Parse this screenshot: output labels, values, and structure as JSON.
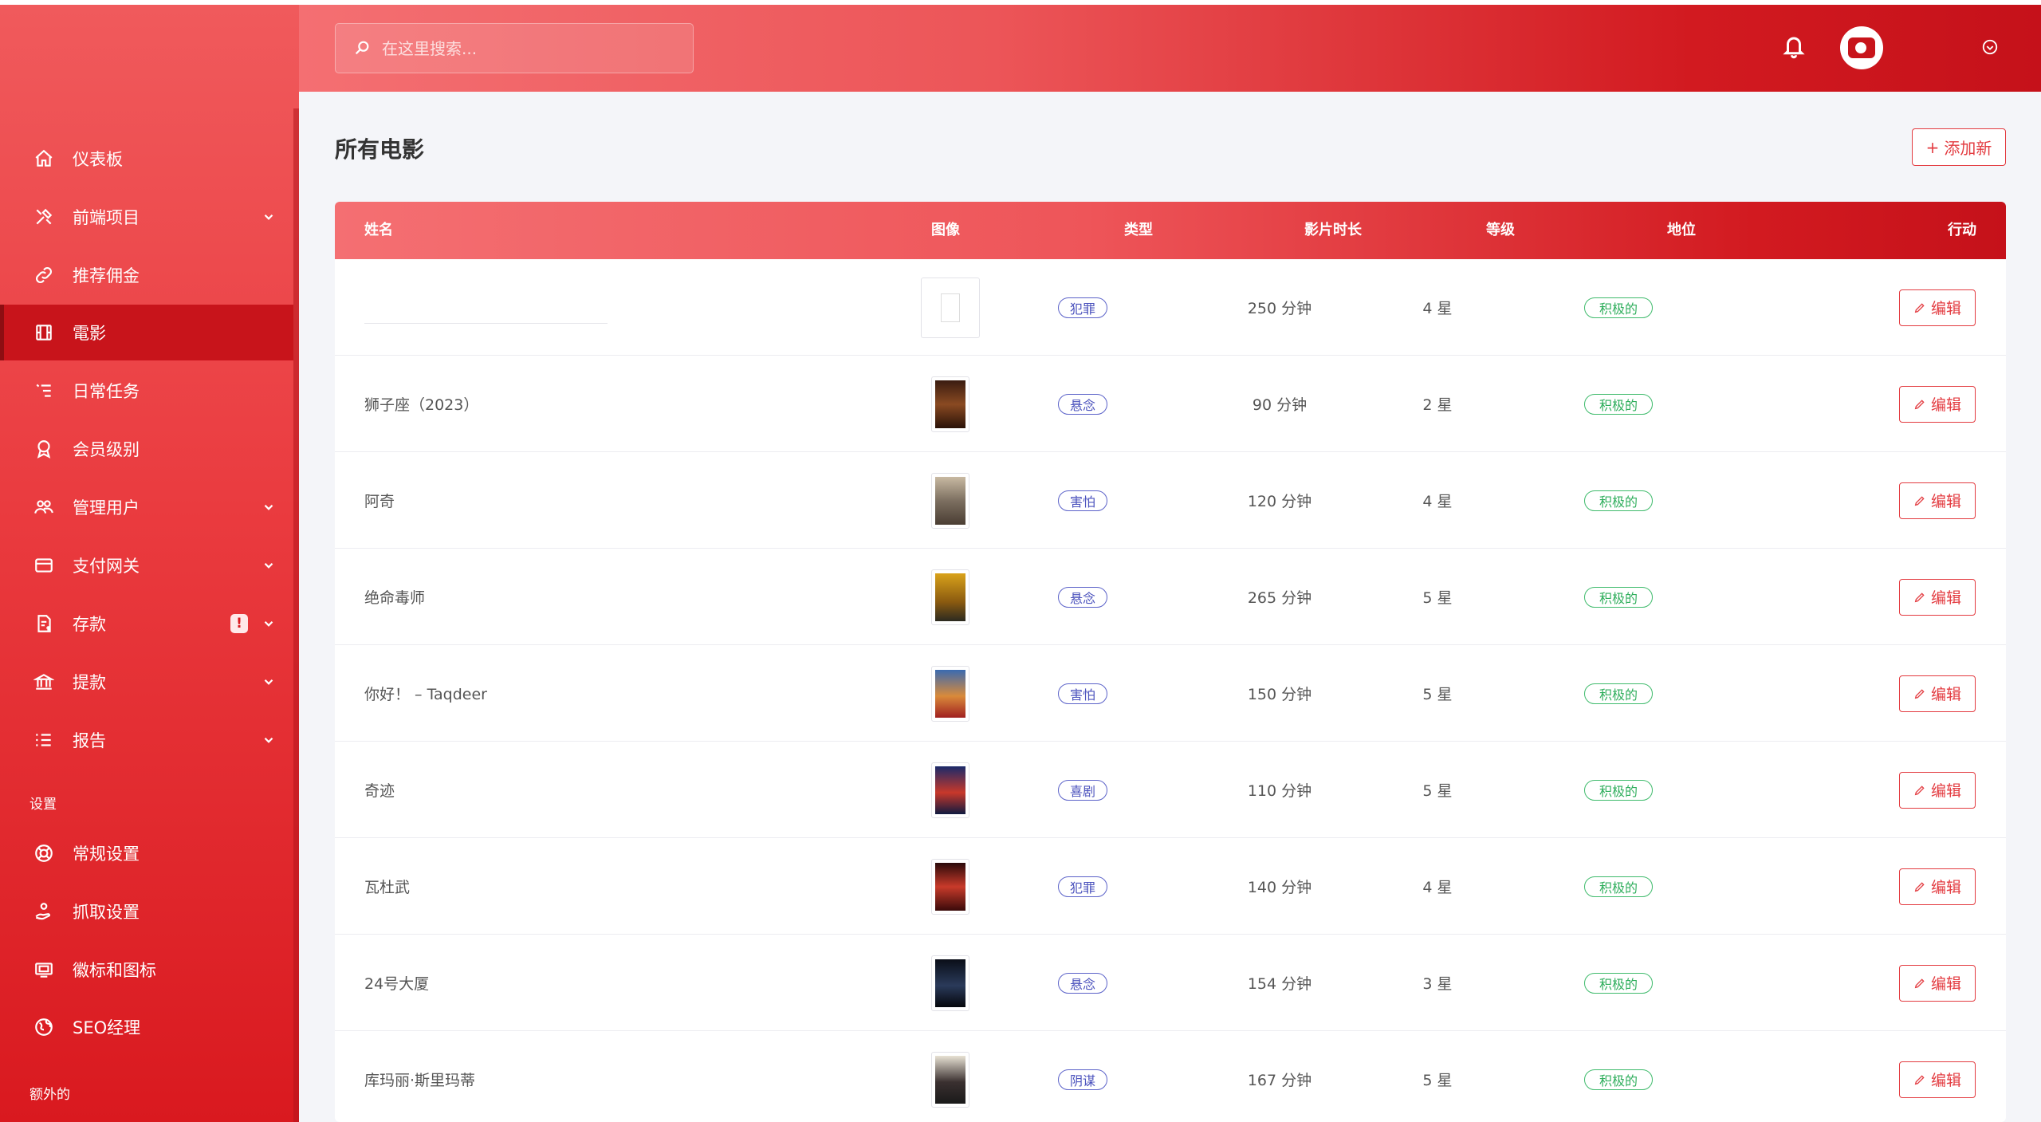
{
  "search": {
    "placeholder": "在这里搜索..."
  },
  "sidebar": {
    "items": [
      {
        "label": "仪表板",
        "icon": "home-icon",
        "has_submenu": false
      },
      {
        "label": "前端项目",
        "icon": "tools-icon",
        "has_submenu": true
      },
      {
        "label": "推荐佣金",
        "icon": "link-icon",
        "has_submenu": false
      },
      {
        "label": "電影",
        "icon": "film-icon",
        "has_submenu": false,
        "active": true
      },
      {
        "label": "日常任务",
        "icon": "task-list-icon",
        "has_submenu": false
      },
      {
        "label": "会员级别",
        "icon": "award-icon",
        "has_submenu": false
      },
      {
        "label": "管理用户",
        "icon": "users-icon",
        "has_submenu": true
      },
      {
        "label": "支付网关",
        "icon": "credit-card-icon",
        "has_submenu": true
      },
      {
        "label": "存款",
        "icon": "deposit-icon",
        "has_submenu": true,
        "badge": "!"
      },
      {
        "label": "提款",
        "icon": "bank-icon",
        "has_submenu": true
      },
      {
        "label": "报告",
        "icon": "report-list-icon",
        "has_submenu": true
      }
    ],
    "settings_label": "设置",
    "settings_items": [
      {
        "label": "常规设置",
        "icon": "lifebuoy-icon"
      },
      {
        "label": "抓取设置",
        "icon": "hand-coin-icon"
      },
      {
        "label": "徽标和图标",
        "icon": "monitor-icon"
      },
      {
        "label": "SEO经理",
        "icon": "globe-icon"
      }
    ],
    "extra_label": "额外的"
  },
  "page": {
    "title": "所有电影",
    "add_button": "添加新"
  },
  "table": {
    "headers": [
      "姓名",
      "图像",
      "类型",
      "影片时长",
      "等级",
      "地位",
      "行动"
    ],
    "rows": [
      {
        "name": "",
        "poster": "blank",
        "genre": "犯罪",
        "length": "250 分钟",
        "grade": "4 星",
        "status": "积极的",
        "action": "编辑"
      },
      {
        "name": "狮子座（2023）",
        "poster": "leo",
        "genre": "悬念",
        "length": "90 分钟",
        "grade": "2 星",
        "status": "积极的",
        "action": "编辑"
      },
      {
        "name": "阿奇",
        "poster": "archie",
        "genre": "害怕",
        "length": "120 分钟",
        "grade": "4 星",
        "status": "积极的",
        "action": "编辑"
      },
      {
        "name": "绝命毒师",
        "poster": "breakingbad",
        "genre": "悬念",
        "length": "265 分钟",
        "grade": "5 星",
        "status": "积极的",
        "action": "编辑"
      },
      {
        "name": "你好！ – Taqdeer",
        "poster": "taqdeer",
        "genre": "害怕",
        "length": "150 分钟",
        "grade": "5 星",
        "status": "积极的",
        "action": "编辑"
      },
      {
        "name": "奇迹",
        "poster": "marvels",
        "genre": "喜剧",
        "length": "110 分钟",
        "grade": "5 星",
        "status": "积极的",
        "action": "编辑"
      },
      {
        "name": "瓦杜武",
        "poster": "vadhuvu",
        "genre": "犯罪",
        "length": "140 分钟",
        "grade": "4 星",
        "status": "积极的",
        "action": "编辑"
      },
      {
        "name": "24号大厦",
        "poster": "mansion24",
        "genre": "悬念",
        "length": "154 分钟",
        "grade": "3 星",
        "status": "积极的",
        "action": "编辑"
      },
      {
        "name": "库玛丽·斯里玛蒂",
        "poster": "kumari",
        "genre": "阴谋",
        "length": "167 分钟",
        "grade": "5 星",
        "status": "积极的",
        "action": "编辑"
      }
    ]
  },
  "colors": {
    "brand_red": "#d9191f",
    "accent_red": "#e33b40",
    "genre_pill": "#4b52bd",
    "status_pill": "#2fae5c"
  }
}
